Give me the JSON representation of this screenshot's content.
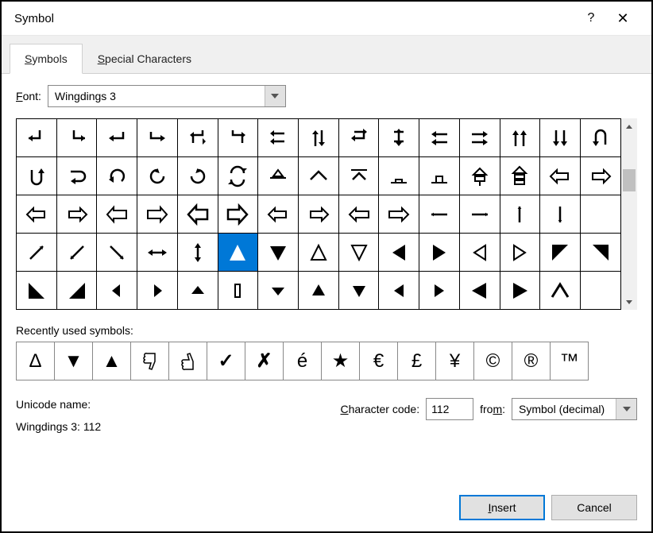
{
  "titlebar": {
    "title": "Symbol",
    "help": "?",
    "close": "✕"
  },
  "tabs": {
    "symbols": "Symbols",
    "special": "Special Characters"
  },
  "font": {
    "label": "Font:",
    "value": "Wingdings 3"
  },
  "grid": {
    "rows": [
      [
        "down-left",
        "down-right",
        "return-left",
        "return-right",
        "branch-left",
        "branch-right",
        "swap-left",
        "up-down",
        "cycle-1",
        "cycle-2",
        "double-left",
        "double-right",
        "double-up",
        "double-down",
        "u-turn-down"
      ],
      [
        "u-turn-up",
        "redo",
        "undo",
        "clockwise",
        "counter-clockwise",
        "refresh",
        "up-slant",
        "caret-up",
        "caret-top",
        "box-low",
        "box-high",
        "eject-up",
        "eject-mid",
        "hollow-left",
        "hollow-right"
      ],
      [
        "outline-left",
        "outline-right",
        "wide-left",
        "wide-right",
        "big-left",
        "big-right",
        "arrow-left-o",
        "arrow-right-o",
        "arrow-left-w",
        "arrow-right-w",
        "thin-left",
        "thin-right",
        "thin-up",
        "thin-down",
        "blank-a"
      ],
      [
        "diag-ne",
        "diag-sw",
        "diag-se",
        "lr",
        "ud",
        "tri-up-sel",
        "tri-down",
        "tri-outline-up",
        "tri-outline-down",
        "tri-left",
        "tri-right",
        "tri-outline-left",
        "tri-outline-right",
        "corner-tl",
        "corner-tr"
      ],
      [
        "corner-bl",
        "corner-br",
        "small-left",
        "small-right",
        "small-up",
        "vrect",
        "small-down",
        "fill-up",
        "fill-down",
        "fill-left",
        "fill-right",
        "big-tri-left",
        "big-tri-right",
        "a-up",
        "blank-b"
      ]
    ],
    "selected": [
      3,
      5
    ]
  },
  "recent": {
    "label": "Recently used symbols:",
    "items": [
      "Δ",
      "▼",
      "▲",
      "thumbs-down",
      "thumbs-up",
      "✓",
      "✗",
      "é",
      "★",
      "€",
      "£",
      "¥",
      "©",
      "®",
      "™"
    ]
  },
  "info": {
    "name_label": "Unicode name:",
    "name_value": "Wingdings 3: 112",
    "code_label": "Character code:",
    "code_value": "112",
    "from_label": "from:",
    "from_value": "Symbol (decimal)"
  },
  "buttons": {
    "insert": "Insert",
    "cancel": "Cancel"
  }
}
